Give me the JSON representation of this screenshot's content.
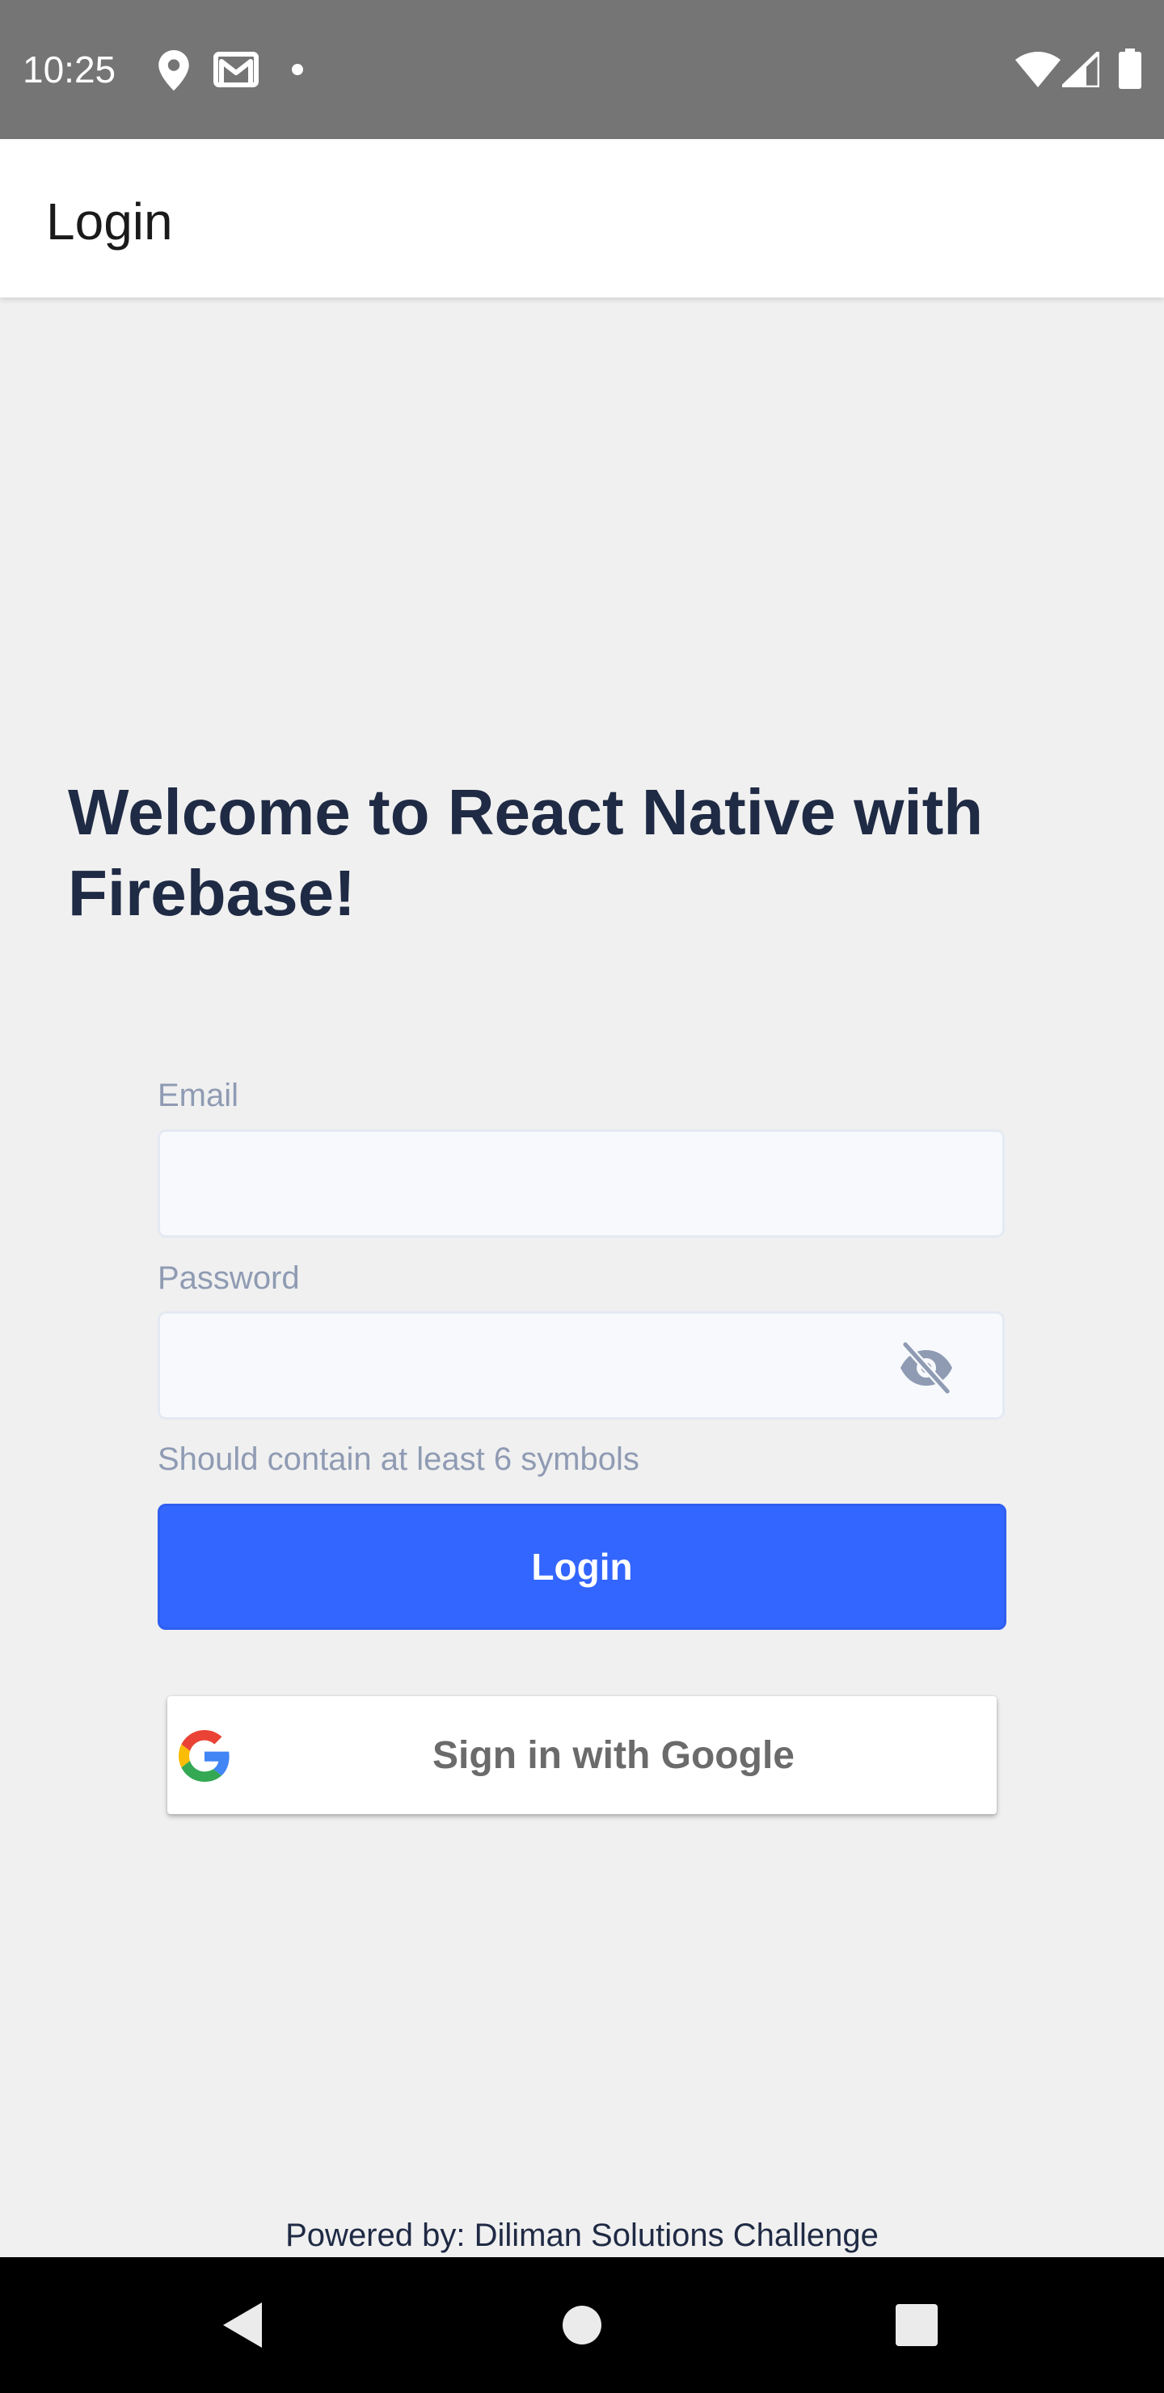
{
  "status_bar": {
    "time": "10:25",
    "left_icons": [
      "location-icon",
      "gmail-icon",
      "notification-dot-icon"
    ],
    "right_icons": [
      "wifi-icon",
      "cellular-signal-icon",
      "battery-icon"
    ]
  },
  "app_bar": {
    "title": "Login"
  },
  "welcome": {
    "heading": "Welcome to React Native with Firebase!"
  },
  "form": {
    "email_label": "Email",
    "email_value": "",
    "password_label": "Password",
    "password_value": "",
    "password_hint": "Should contain at least 6 symbols",
    "login_button": "Login"
  },
  "google": {
    "label": "Sign in with Google"
  },
  "footer": {
    "powered_by": "Powered by: Diliman Solutions Challenge"
  },
  "nav_bar": {
    "icons": [
      "back-icon",
      "home-icon",
      "recents-icon"
    ]
  },
  "colors": {
    "status_bar": "#757575",
    "background": "#f0f0f0",
    "heading": "#1f2a44",
    "label": "#8f9bb3",
    "input_bg": "#f7f9fc",
    "input_border": "#e4e9f2",
    "primary": "#3366ff",
    "google_text": "#6b6b6b"
  }
}
